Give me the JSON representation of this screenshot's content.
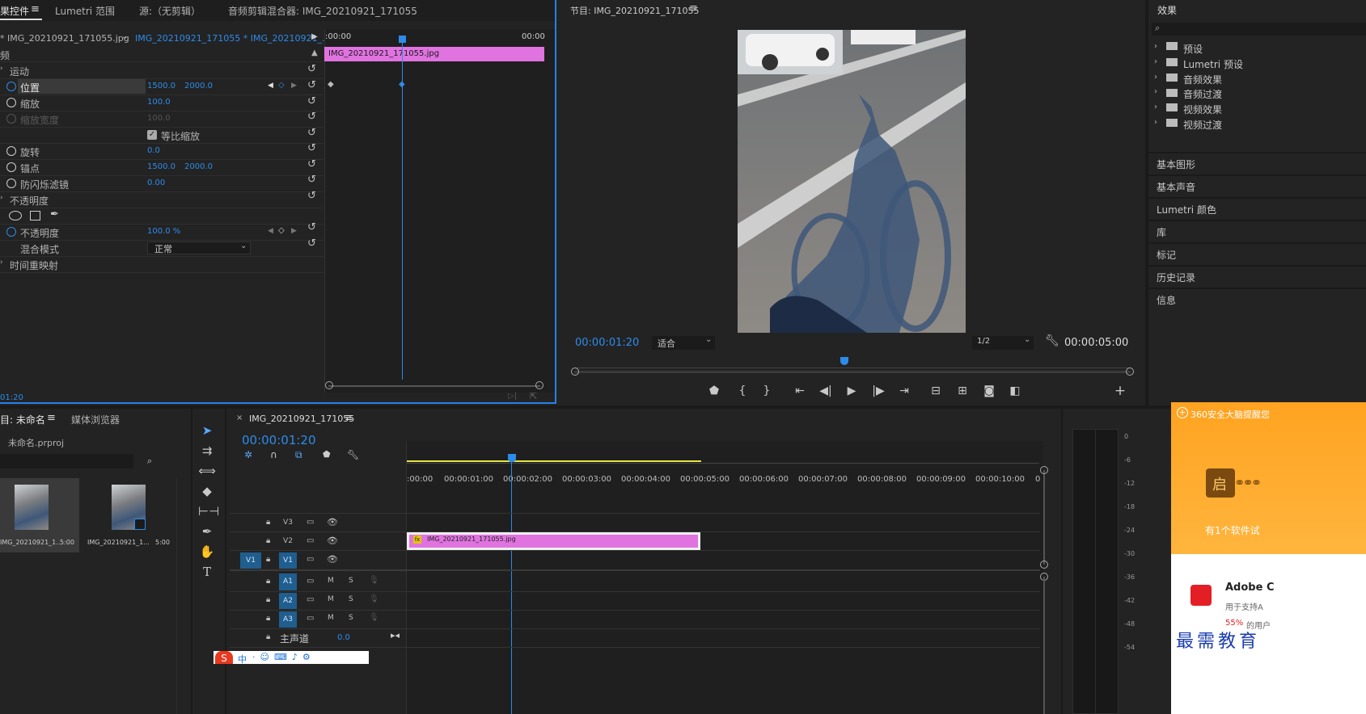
{
  "effect_controls": {
    "tabs": {
      "effect_controls": "果控件",
      "lumetri_scope": "Lumetri 范围",
      "source": "源:（无剪辑）",
      "audio_mixer": "音频剪辑混合器: IMG_20210921_171055"
    },
    "clip_select": "* IMG_20210921_171055.jpg",
    "sequence_select": "IMG_20210921_171055 * IMG_20210921_...",
    "section_video": "频",
    "motion": {
      "label": "运动",
      "position": {
        "label": "位置",
        "x": "1500.0",
        "y": "2000.0"
      },
      "scale": {
        "label": "缩放",
        "value": "100.0"
      },
      "scale_width": {
        "label": "缩放宽度",
        "value": "100.0"
      },
      "uniform_scale": "等比缩放",
      "rotation": {
        "label": "旋转",
        "value": "0.0"
      },
      "anchor": {
        "label": "锚点",
        "x": "1500.0",
        "y": "2000.0"
      },
      "anti_flicker": {
        "label": "防闪烁滤镜",
        "value": "0.00"
      }
    },
    "opacity": {
      "label": "不透明度",
      "opacity": {
        "label": "不透明度",
        "value": "100.0 %"
      },
      "blend": {
        "label": "混合模式",
        "value": "正常"
      }
    },
    "time_remap": "时间重映射",
    "timeline": {
      "start": ":00:00",
      "end": "00:00",
      "clip": "IMG_20210921_171055.jpg"
    },
    "timecode": "01:20"
  },
  "program": {
    "title": "节目: IMG_20210921_171055",
    "timecode": "00:00:01:20",
    "fit": "适合",
    "quality": "1/2",
    "duration": "00:00:05:00",
    "playhead_fraction": 0.485
  },
  "effects": {
    "title": "效果",
    "search_placeholder": "",
    "items": [
      "预设",
      "Lumetri 预设",
      "音频效果",
      "音频过渡",
      "视频效果",
      "视频过渡"
    ],
    "panels": [
      "基本图形",
      "基本声音",
      "Lumetri 颜色",
      "库",
      "标记",
      "历史记录",
      "信息"
    ]
  },
  "project": {
    "tabs": {
      "project": "目: 未命名",
      "media_browser": "媒体浏览器"
    },
    "file": "未命名.prproj",
    "items": [
      {
        "name": "IMG_20210921_1...",
        "duration": "5:00"
      },
      {
        "name": "IMG_20210921_1...",
        "duration": "5:00"
      }
    ]
  },
  "sequence": {
    "tab": "IMG_20210921_171055",
    "timecode": "00:00:01:20",
    "ruler": [
      ":00:00",
      "00:00:01:00",
      "00:00:02:00",
      "00:00:03:00",
      "00:00:04:00",
      "00:00:05:00",
      "00:00:06:00",
      "00:00:07:00",
      "00:00:08:00",
      "00:00:09:00",
      "00:00:10:00",
      "0"
    ],
    "video_tracks": [
      "V3",
      "V2",
      "V1"
    ],
    "source_patch": "V1",
    "audio_tracks": [
      "A1",
      "A2",
      "A3"
    ],
    "master": {
      "label": "主声道",
      "value": "0.0"
    },
    "clip": {
      "fx": "fx",
      "name": "IMG_20210921_171055.jpg"
    },
    "mute_label": "M",
    "solo_label": "S"
  },
  "meter": {
    "scale": [
      "0",
      "-6",
      "-12",
      "-18",
      "-24",
      "-30",
      "-36",
      "-42",
      "-48",
      "-54"
    ]
  },
  "ad": {
    "header": "360安全大脑提醒您",
    "badge": "启",
    "line": "有1个软件试",
    "app": "Adobe C",
    "sub": "用于支持A",
    "pct": "55%",
    "pct_tail": "的用户",
    "watermark": "最需教育"
  },
  "ime": {
    "label": "中"
  }
}
